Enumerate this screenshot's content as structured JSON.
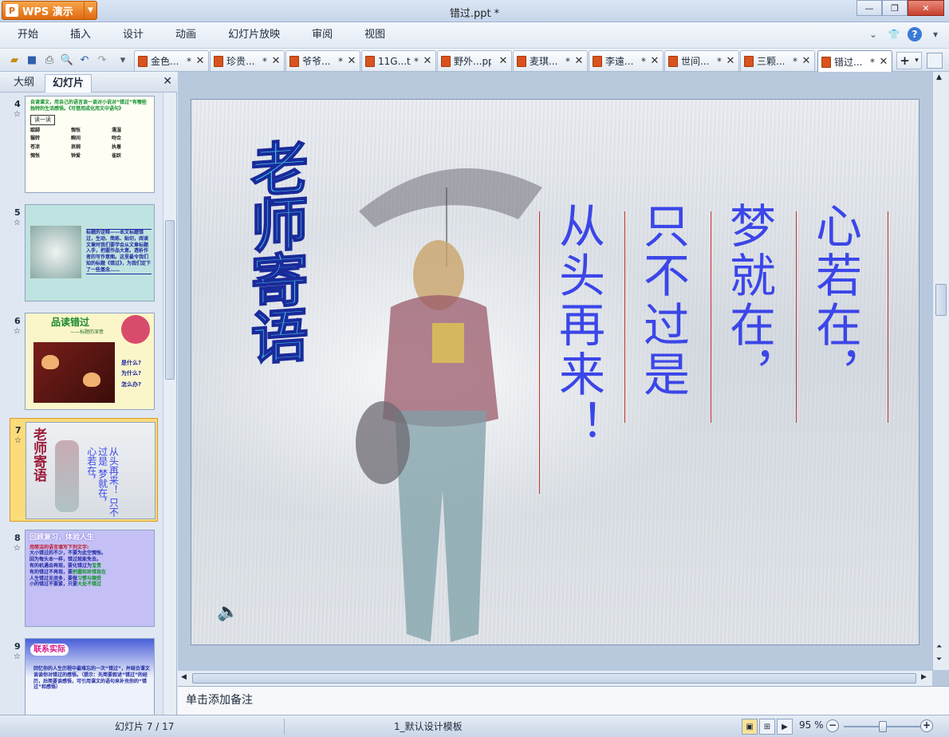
{
  "app": {
    "name": "WPS 演示",
    "doc_title": "错过.ppt *"
  },
  "menu": [
    "开始",
    "插入",
    "设计",
    "动画",
    "幻灯片放映",
    "审阅",
    "视图"
  ],
  "tabs": [
    {
      "label": "金色...",
      "mark": "*"
    },
    {
      "label": "珍贵...",
      "mark": "*"
    },
    {
      "label": "爷爷...",
      "mark": "*"
    },
    {
      "label": "11G...t",
      "mark": "*"
    },
    {
      "label": "野外...ppt",
      "mark": ""
    },
    {
      "label": "麦琪...",
      "mark": "*"
    },
    {
      "label": "李遠...",
      "mark": "*"
    },
    {
      "label": "世间...",
      "mark": "*"
    },
    {
      "label": "三颗...",
      "mark": "*"
    },
    {
      "label": "错过...",
      "mark": "*"
    }
  ],
  "panel": {
    "tab_outline": "大纲",
    "tab_slides": "幻灯片"
  },
  "thumbnails": [
    {
      "num": "4",
      "t1": "自读课文，用自己的语言谈一谈对小说对“错过”有哪些独特的生活感悟。《可借用成化用文中语句》",
      "t2": "读一读",
      "words": [
        "踮脚",
        "惆怅",
        "濡湿",
        "辗转",
        "瞬间",
        "吻合",
        "苍凉",
        "哀婉",
        "执着",
        "惆怅",
        "钟爱",
        "雀跃"
      ]
    },
    {
      "num": "5",
      "t1": "标题的诠释——本文标题错过，生动、简练、贴切，阅读文章时我们要学会从文章标题入手，把握作品大意。透析作者的写作意图。这里最令我们知的标题《错过》，为我们定下了一些基念……"
    },
    {
      "num": "6",
      "t1": "品读错过",
      "t2": "——标题的深意",
      "t3": "是什么?",
      "t4": "为什么?",
      "t5": "怎么办?"
    },
    {
      "num": "7"
    },
    {
      "num": "8",
      "t1": "回顾复习，体验人生",
      "t2": "用简洁的语言填写下列文字:",
      "lines": [
        "大小错过的不少，不要为此空惆怅。",
        "因为每头本一样，错过就能免去。",
        "有的机遇会再现，要化错过为",
        "有的错过不再现，要",
        "人生错过无须多，要做",
        "小的错过不要紧，只要"
      ],
      "fills": [
        "宝贵",
        "把握和珍惜现在",
        "习惯与顺受",
        "大处不错过"
      ]
    },
    {
      "num": "9",
      "t1": "联系实际",
      "t2": "回忆你的人生历程中最难忘的一次“错过”，并结合课文谈谈你对错过的感悟。（提示：先简要叙述“错过”的经历，后简要谈感悟，可引用课文的语句来补充你的“错过”和感悟）"
    }
  ],
  "slide": {
    "title": "老师寄语",
    "poem_lines": [
      "心若在，",
      "梦就在，",
      "只不过是",
      "从头再来！"
    ]
  },
  "notes_placeholder": "单击添加备注",
  "status": {
    "slide_counter": "幻灯片 7 / 17",
    "template": "1_默认设计模板",
    "zoom": "95 %",
    "zoom_level": 0.5
  }
}
